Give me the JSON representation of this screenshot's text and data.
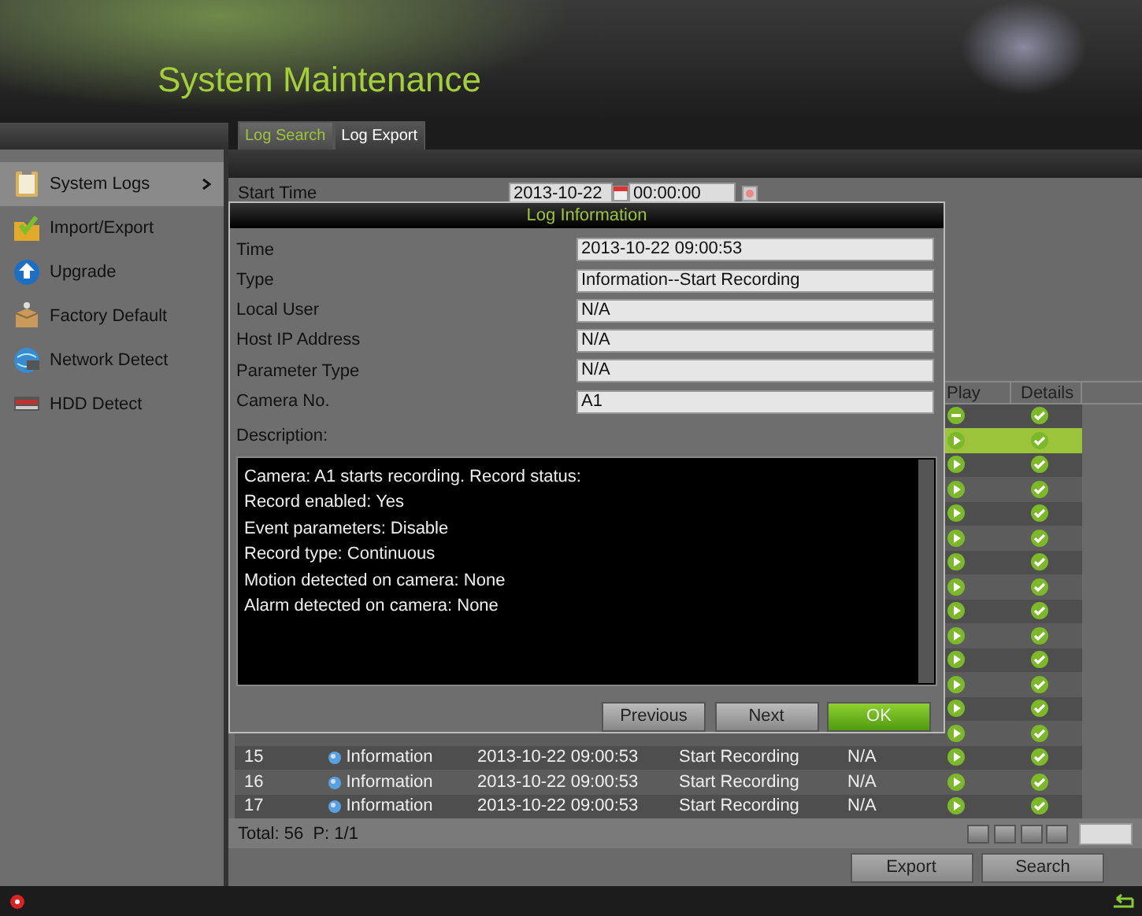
{
  "header": {
    "title": "System Maintenance"
  },
  "tabs": [
    {
      "label": "Log Search",
      "selected": true
    },
    {
      "label": "Log Export",
      "selected": false
    }
  ],
  "sidebar": {
    "items": [
      {
        "label": "System Logs",
        "selected": true
      },
      {
        "label": "Import/Export",
        "selected": false
      },
      {
        "label": "Upgrade",
        "selected": false
      },
      {
        "label": "Factory Default",
        "selected": false
      },
      {
        "label": "Network Detect",
        "selected": false
      },
      {
        "label": "HDD Detect",
        "selected": false
      }
    ]
  },
  "search_form": {
    "start_time": {
      "label": "Start Time",
      "date": "2013-10-22",
      "time": "00:00:00"
    }
  },
  "table": {
    "columns": [
      "Play",
      "Details"
    ],
    "rows": [
      {
        "playable": false,
        "selected": false
      },
      {
        "playable": true,
        "selected": true
      },
      {
        "playable": true,
        "selected": false
      },
      {
        "playable": true,
        "selected": false
      },
      {
        "playable": true,
        "selected": false
      },
      {
        "playable": true,
        "selected": false
      },
      {
        "playable": true,
        "selected": false
      },
      {
        "playable": true,
        "selected": false
      },
      {
        "playable": true,
        "selected": false
      },
      {
        "playable": true,
        "selected": false
      },
      {
        "playable": true,
        "selected": false
      },
      {
        "playable": true,
        "selected": false
      },
      {
        "playable": true,
        "selected": false
      },
      {
        "playable": true,
        "selected": false
      },
      {
        "number": "15",
        "type": "Information",
        "time": "2013-10-22 09:00:53",
        "event": "Start Recording",
        "user": "N/A",
        "playable": true,
        "selected": false
      },
      {
        "number": "16",
        "type": "Information",
        "time": "2013-10-22 09:00:53",
        "event": "Start Recording",
        "user": "N/A",
        "playable": true,
        "selected": false
      },
      {
        "number": "17",
        "type": "Information",
        "time": "2013-10-22 09:00:53",
        "event": "Start Recording",
        "user": "N/A",
        "playable": true,
        "selected": false
      }
    ],
    "summary": "Total: 56  P: 1/1"
  },
  "buttons": [
    "Export",
    "Search"
  ],
  "dialog": {
    "title": "Log Information",
    "fields": [
      {
        "label": "Time",
        "value": "2013-10-22 09:00:53"
      },
      {
        "label": "Type",
        "value": "Information--Start Recording"
      },
      {
        "label": "Local User",
        "value": "N/A"
      },
      {
        "label": "Host IP Address",
        "value": "N/A"
      },
      {
        "label": "Parameter Type",
        "value": "N/A"
      },
      {
        "label": "Camera No.",
        "value": "A1"
      }
    ],
    "description_label": "Description:",
    "description_lines": [
      "Camera: A1 starts recording. Record status:",
      "Record enabled: Yes",
      "Event parameters: Disable",
      "Record type: Continuous",
      "Motion detected on camera: None",
      "Alarm detected on camera: None"
    ],
    "buttons": [
      {
        "label": "Previous",
        "kind": "normal"
      },
      {
        "label": "Next",
        "kind": "normal"
      },
      {
        "label": "OK",
        "kind": "primary"
      }
    ]
  }
}
